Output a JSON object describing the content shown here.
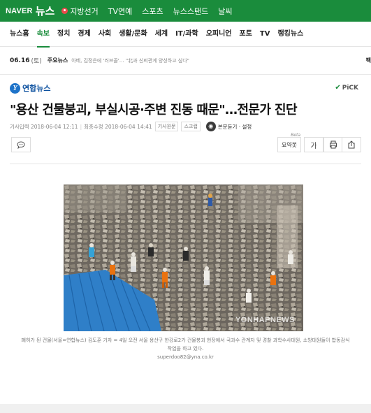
{
  "topbar": {
    "logo_naver": "NAVER",
    "logo_news": "뉴스",
    "nav": [
      "지방선거",
      "TV연예",
      "스포츠",
      "뉴스스탠드",
      "날씨"
    ],
    "brand_color": "#1a8c3c"
  },
  "categories": {
    "items": [
      "뉴스홈",
      "속보",
      "정치",
      "경제",
      "사회",
      "생활/문화",
      "세계",
      "IT/과학",
      "오피니언",
      "포토",
      "TV",
      "랭킹뉴스"
    ],
    "active": "속보"
  },
  "strip": {
    "date": "06.16",
    "day": "(토)",
    "main_label": "주요뉴스",
    "ticker": "아베, 김정은에 '러브콜'… \"北과 신뢰관계 양성하고 싶다\"",
    "edge_text": "팩"
  },
  "article": {
    "press_name": "연합뉴스",
    "pick_label": "PiCK",
    "headline": "\"용산 건물붕괴, 부실시공·주변 진동 때문\"…전문가 진단",
    "published": "기사입력 2018-06-04 12:11",
    "modified": "최종수정 2018-06-04 14:41",
    "chip_original": "기사원문",
    "chip_scrap": "스크랩",
    "listen_label": "본문듣기 · 설정",
    "summary_label": "요약봇",
    "summary_beta": "Beta",
    "font_label": "가"
  },
  "photo": {
    "watermark": "YONHAPNEWS",
    "caption": "폐허가 된 건물(서울=연합뉴스) 김도훈 기자 = 4일 오전 서울 용산구 한강로2가 건물붕괴 현장에서 국과수 관계자 및 경찰 과학수사대원, 소방대원들이 합동감식작업을 하고 있다.",
    "email": "superdoo82@yna.co.kr"
  }
}
